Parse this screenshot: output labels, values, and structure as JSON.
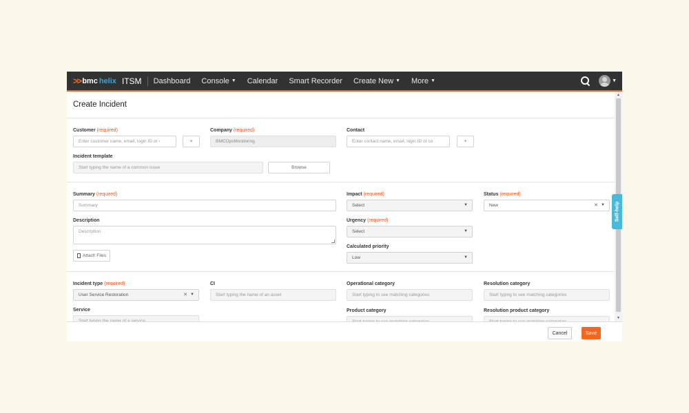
{
  "brand": {
    "bmc": "bmc",
    "helix": "helix",
    "product": "ITSM"
  },
  "nav": {
    "dashboard": "Dashboard",
    "console": "Console",
    "calendar": "Calendar",
    "smart_recorder": "Smart Recorder",
    "create_new": "Create New",
    "more": "More"
  },
  "page_title": "Create Incident",
  "required_text": "(required)",
  "section1": {
    "customer_label": "Customer",
    "customer_placeholder": "Enter customer name, email, login ID or ‹",
    "add_label": "+",
    "company_label": "Company",
    "company_value": "BMCOpsMonitoring",
    "contact_label": "Contact",
    "contact_placeholder": "Enter contact name, email, login ID or co",
    "template_label": "Incident template",
    "template_placeholder": "Start typing the name of a common issue",
    "browse_label": "Browse"
  },
  "section2": {
    "summary_label": "Summary",
    "summary_placeholder": "Summary",
    "description_label": "Description",
    "description_placeholder": "Description",
    "attach_label": "Attach Files",
    "impact_label": "Impact",
    "impact_value": "Select",
    "urgency_label": "Urgency",
    "urgency_value": "Select",
    "priority_label": "Calculated priority",
    "priority_value": "Low",
    "status_label": "Status",
    "status_value": "New"
  },
  "section3": {
    "incident_type_label": "Incident type",
    "incident_type_value": "User Service Restoration",
    "ci_label": "CI",
    "ci_placeholder": "Start typing the name of an asset",
    "op_cat_label": "Operational category",
    "op_cat_placeholder": "Start typing to see matching categories",
    "res_cat_label": "Resolution category",
    "res_cat_placeholder": "Start typing to see matching categories",
    "service_label": "Service",
    "service_placeholder": "Start typing the name of a service",
    "product_cat_label": "Product category",
    "product_cat_placeholder": "Start typing to see matching categories",
    "res_product_cat_label": "Resolution product category",
    "res_product_cat_placeholder": "Start typing to see matching categories"
  },
  "selfhelp_label": "Self-help",
  "footer": {
    "cancel": "Cancel",
    "save": "Save"
  },
  "colors": {
    "accent": "#f26722",
    "required": "#e8541c",
    "topbar": "#323232",
    "selfhelp": "#4ab8d8"
  }
}
